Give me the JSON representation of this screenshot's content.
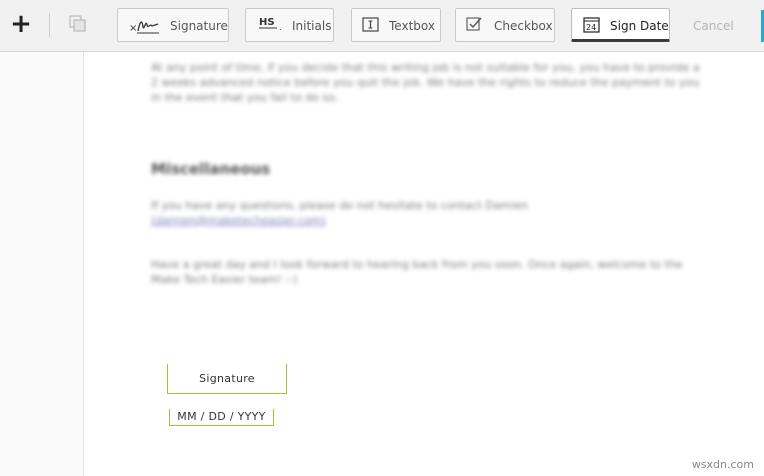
{
  "toolbar": {
    "tools": [
      {
        "label": "Signature",
        "icon": "signature-icon"
      },
      {
        "label": "Initials",
        "icon": "initials-icon"
      },
      {
        "label": "Textbox",
        "icon": "textbox-icon"
      },
      {
        "label": "Checkbox",
        "icon": "checkbox-icon"
      },
      {
        "label": "Sign Date",
        "icon": "calendar-icon",
        "active": true
      }
    ],
    "initials_icon_text": "HS",
    "calendar_icon_text": "24",
    "cancel_label": "Cancel",
    "add_icon": "plus-icon",
    "copy_icon": "copy-icon"
  },
  "document": {
    "paragraph_1": "At any point of time, if you decide that this writing job is not suitable for you, you have to provide a 2 weeks advanced notice before you quit the job. We have the rights to reduce the payment to you in the event that you fail to do so.",
    "heading": "Miscellaneous",
    "paragraph_2_text": "If you have any questions, please do not hesitate to contact Damien",
    "paragraph_2_link": "(damien@maketecheasier.com)",
    "paragraph_3": "Have a great day and I look forward to hearing back from you soon. Once again, welcome to the Make Tech Easier team! :-)"
  },
  "fields": {
    "signature_label": "Signature",
    "date_placeholder": "MM / DD  / YYYY"
  },
  "watermark": "wsxdn.com",
  "colors": {
    "field_border": "#a9bf3b",
    "active_tool_underline": "#3a3a3a",
    "edge_accent": "#2aa7d9"
  }
}
